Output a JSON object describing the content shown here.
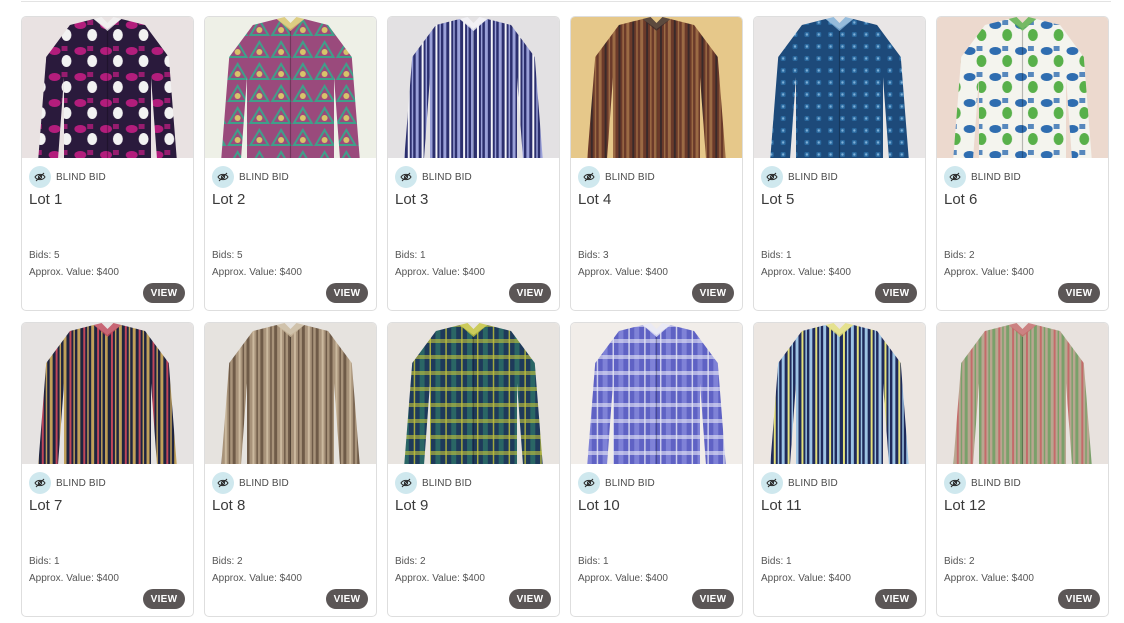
{
  "lots": [
    {
      "badge": "BLIND BID",
      "title": "Lot 1",
      "bids": "Bids: 5",
      "value": "Approx. Value: $400",
      "view": "VIEW",
      "bg": "#e9e2e2",
      "c1": "#2a1a3c",
      "c2": "#b31d7c",
      "c3": "#f2f2f2",
      "pattern": "blotch"
    },
    {
      "badge": "BLIND BID",
      "title": "Lot 2",
      "bids": "Bids: 5",
      "value": "Approx. Value: $400",
      "view": "VIEW",
      "bg": "#eef0e7",
      "c1": "#9a4a7c",
      "c2": "#3fa08a",
      "c3": "#d8c46a",
      "pattern": "paisley"
    },
    {
      "badge": "BLIND BID",
      "title": "Lot 3",
      "bids": "Bids: 1",
      "value": "Approx. Value: $400",
      "view": "VIEW",
      "bg": "#e3e1e3",
      "c1": "#2c2f6e",
      "c2": "#9aa0d8",
      "c3": "#f4f4f8",
      "pattern": "stripes"
    },
    {
      "badge": "BLIND BID",
      "title": "Lot 4",
      "bids": "Bids: 3",
      "value": "Approx. Value: $400",
      "view": "VIEW",
      "bg": "#e6c88a",
      "c1": "#6b3a2a",
      "c2": "#9b6a44",
      "c3": "#3a2a2a",
      "pattern": "stripes"
    },
    {
      "badge": "BLIND BID",
      "title": "Lot 5",
      "bids": "Bids: 1",
      "value": "Approx. Value: $400",
      "view": "VIEW",
      "bg": "#e9e6e6",
      "c1": "#1d4a7a",
      "c2": "#2b6aa0",
      "c3": "#7fb0d8",
      "pattern": "dots"
    },
    {
      "badge": "BLIND BID",
      "title": "Lot 6",
      "bids": "Bids: 2",
      "value": "Approx. Value: $400",
      "view": "VIEW",
      "bg": "#ecd9ce",
      "c1": "#f4f4ee",
      "c2": "#2f6db0",
      "c3": "#58b04a",
      "pattern": "blotch"
    },
    {
      "badge": "BLIND BID",
      "title": "Lot 7",
      "bids": "Bids: 1",
      "value": "Approx. Value: $400",
      "view": "VIEW",
      "bg": "#e6e3e2",
      "c1": "#1f2440",
      "c2": "#c0a05a",
      "c3": "#c0465a",
      "pattern": "stripes"
    },
    {
      "badge": "BLIND BID",
      "title": "Lot 8",
      "bids": "Bids: 2",
      "value": "Approx. Value: $400",
      "view": "VIEW",
      "bg": "#e6e3df",
      "c1": "#a8937a",
      "c2": "#6f5b48",
      "c3": "#cbb99e",
      "pattern": "stripes"
    },
    {
      "badge": "BLIND BID",
      "title": "Lot 9",
      "bids": "Bids: 2",
      "value": "Approx. Value: $400",
      "view": "VIEW",
      "bg": "#e8e4e0",
      "c1": "#1e3a5a",
      "c2": "#2f7a6a",
      "c3": "#c4c43a",
      "pattern": "plaid"
    },
    {
      "badge": "BLIND BID",
      "title": "Lot 10",
      "bids": "Bids: 1",
      "value": "Approx. Value: $400",
      "view": "VIEW",
      "bg": "#f1ede9",
      "c1": "#5f62c4",
      "c2": "#8e90e0",
      "c3": "#e8e8f6",
      "pattern": "plaid"
    },
    {
      "badge": "BLIND BID",
      "title": "Lot 11",
      "bids": "Bids: 1",
      "value": "Approx. Value: $400",
      "view": "VIEW",
      "bg": "#ece6e1",
      "c1": "#1f2a5a",
      "c2": "#9ec4e4",
      "c3": "#e4e07a",
      "pattern": "stripes"
    },
    {
      "badge": "BLIND BID",
      "title": "Lot 12",
      "bids": "Bids: 2",
      "value": "Approx. Value: $400",
      "view": "VIEW",
      "bg": "#e8e2de",
      "c1": "#b9a690",
      "c2": "#7aa06a",
      "c3": "#c46a6a",
      "pattern": "stripes"
    }
  ]
}
